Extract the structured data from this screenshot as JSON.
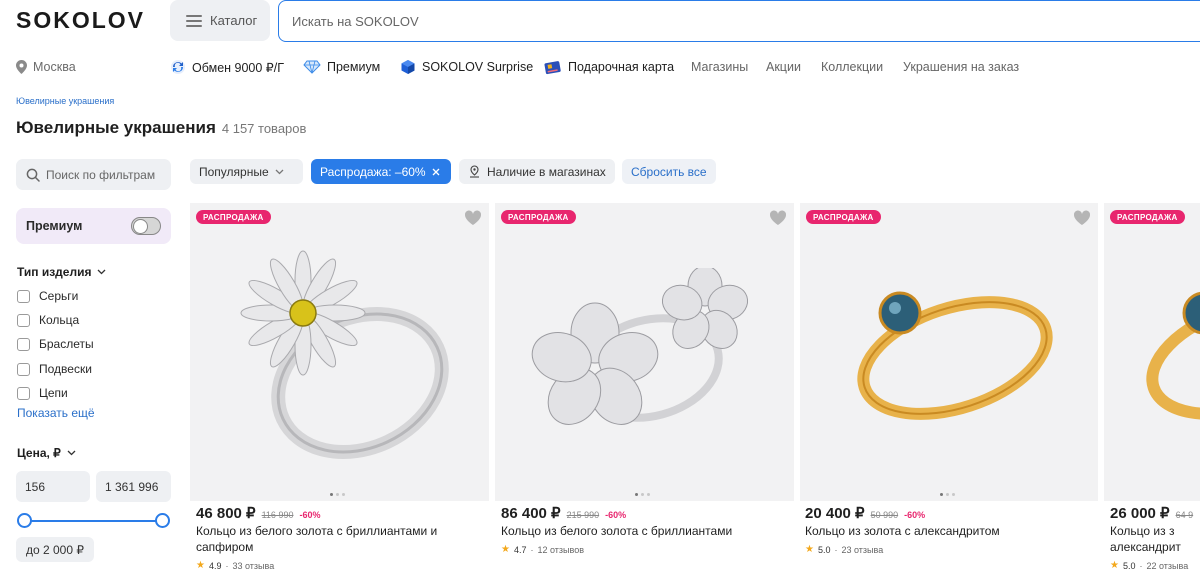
{
  "header": {
    "logo": "SOKOLOV",
    "catalog_label": "Каталог",
    "search_placeholder": "Искать на SOKOLOV"
  },
  "subnav": {
    "city": "Москва",
    "items": [
      {
        "label": "Обмен 9000 ₽/Г",
        "icon": "exchange-icon"
      },
      {
        "label": "Премиум",
        "icon": "diamond-icon"
      },
      {
        "label": "SOKOLOV Surprise",
        "icon": "cube-icon"
      },
      {
        "label": "Подарочная карта",
        "icon": "gift-card-icon"
      },
      {
        "label": "Магазины"
      },
      {
        "label": "Акции"
      },
      {
        "label": "Коллекции"
      },
      {
        "label": "Украшения на заказ"
      }
    ]
  },
  "breadcrumb": "Ювелирные украшения",
  "page": {
    "title": "Ювелирные украшения",
    "count": "4 157 товаров"
  },
  "filters": {
    "search_placeholder": "Поиск по фильтрам",
    "premium_label": "Премиум",
    "type_title": "Тип изделия",
    "types": [
      "Серьги",
      "Кольца",
      "Браслеты",
      "Подвески",
      "Цепи"
    ],
    "show_more": "Показать ещё",
    "price_title": "Цена, ₽",
    "price_min": "156",
    "price_max": "1 361 996",
    "price_chip": "до 2 000 ₽"
  },
  "chips": {
    "sort": "Популярные",
    "sale": "Распродажа: –60%",
    "availability": "Наличие в магазинах",
    "reset": "Сбросить все"
  },
  "products": [
    {
      "badge": "РАСПРОДАЖА",
      "price": "46 800 ₽",
      "old_price": "116 990",
      "discount": "-60%",
      "name": "Кольцо из белого золота с бриллиантами и сапфиром",
      "rating": "4.9",
      "reviews": "33 отзыва"
    },
    {
      "badge": "РАСПРОДАЖА",
      "price": "86 400 ₽",
      "old_price": "215 990",
      "discount": "-60%",
      "name": "Кольцо из белого золота с бриллиантами",
      "rating": "4.7",
      "reviews": "12 отзывов"
    },
    {
      "badge": "РАСПРОДАЖА",
      "price": "20 400 ₽",
      "old_price": "50 990",
      "discount": "-60%",
      "name": "Кольцо из золота с александритом",
      "rating": "5.0",
      "reviews": "23 отзыва"
    },
    {
      "badge": "РАСПРОДАЖА",
      "price": "26 000 ₽",
      "old_price": "64 9",
      "discount": "",
      "name": "Кольцо из з александрит",
      "rating": "5.0",
      "reviews": "22 отзыва"
    }
  ],
  "colors": {
    "accent": "#2a7ce8",
    "sale_badge": "#e8266e",
    "link": "#2a6fc9",
    "premium_bg": "#f1eaf8"
  }
}
